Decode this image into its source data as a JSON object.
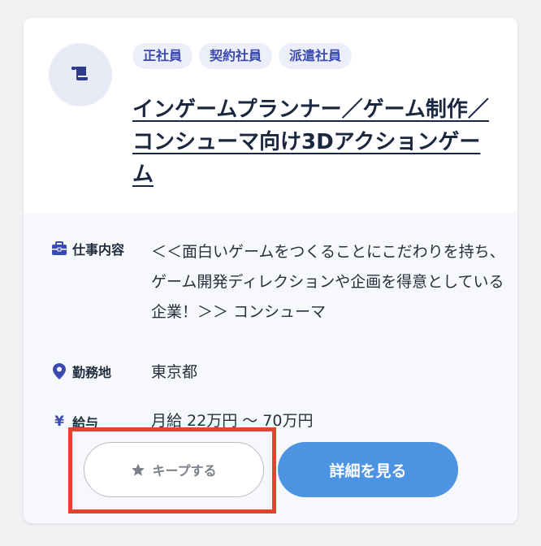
{
  "job": {
    "tags": [
      "正社員",
      "契約社員",
      "派遣社員"
    ],
    "title": "インゲームプランナー／ゲーム制作／コンシューマ向け3Dアクションゲーム",
    "details": {
      "work_label": "仕事内容",
      "work_value": "＜＜面白いゲームをつくることにこだわりを持ち、ゲーム開発ディレクションや企画を得意としている企業！＞＞ コンシューマ",
      "location_label": "勤務地",
      "location_value": "東京都",
      "salary_label": "給与",
      "salary_value": "月給 22万円 〜 70万円"
    },
    "actions": {
      "keep_label": "キープする",
      "detail_label": "詳細を見る"
    }
  },
  "colors": {
    "accent": "#3b4ab0",
    "detail_button": "#4c93e2",
    "highlight_frame": "#e5412f"
  },
  "icons": {
    "company": "scroll-icon",
    "work": "briefcase-icon",
    "location": "map-pin-icon",
    "salary": "yen-icon",
    "keep": "star-icon"
  }
}
